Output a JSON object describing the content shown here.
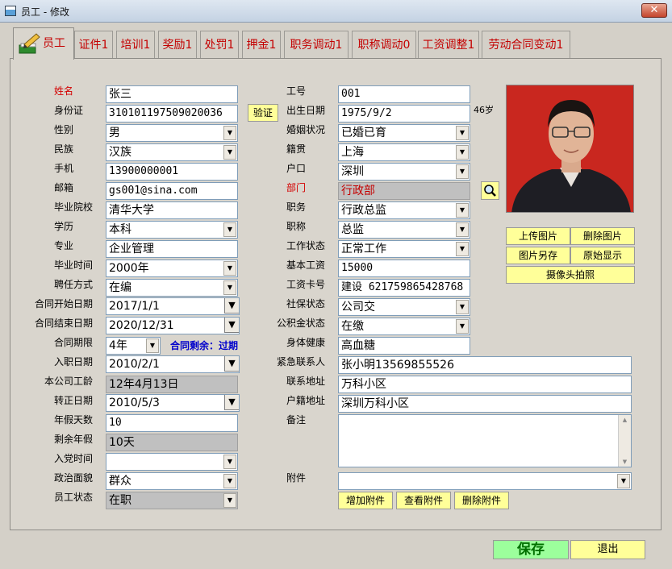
{
  "window": {
    "title": "员工 - 修改",
    "close_glyph": "✕"
  },
  "tabs": [
    "员工",
    "证件1",
    "培训1",
    "奖励1",
    "处罚1",
    "押金1",
    "职务调动1",
    "职称调动0",
    "工资调整1",
    "劳动合同变动1"
  ],
  "labels": {
    "name": "姓名",
    "id_card": "身份证",
    "gender": "性别",
    "ethnicity": "民族",
    "mobile": "手机",
    "email": "邮箱",
    "school": "毕业院校",
    "education": "学历",
    "major": "专业",
    "grad_time": "毕业时间",
    "hire_mode": "聘任方式",
    "contract_start": "合同开始日期",
    "contract_end": "合同结束日期",
    "contract_term": "合同期限",
    "join_date": "入职日期",
    "seniority": "本公司工龄",
    "regular_date": "转正日期",
    "annual_leave": "年假天数",
    "remaining_leave": "剩余年假",
    "party_time": "入党时间",
    "political": "政治面貌",
    "status": "员工状态",
    "emp_no": "工号",
    "birth_date": "出生日期",
    "marital": "婚姻状况",
    "native_place": "籍贯",
    "hukou": "户口",
    "department": "部门",
    "position": "职务",
    "title": "职称",
    "work_status": "工作状态",
    "base_salary": "基本工资",
    "salary_card": "工资卡号",
    "social_security": "社保状态",
    "housing_fund": "公积金状态",
    "health": "身体健康",
    "emergency": "紧急联系人",
    "address": "联系地址",
    "registered_address": "户籍地址",
    "remarks": "备注",
    "attachment": "附件"
  },
  "values": {
    "name": "张三",
    "id_card": "310101197509020036",
    "gender": "男",
    "ethnicity": "汉族",
    "mobile": "13900000001",
    "email": "gs001@sina.com",
    "school": "清华大学",
    "education": "本科",
    "major": "企业管理",
    "grad_time": "2000年",
    "hire_mode": "在编",
    "contract_start": "2017/1/1",
    "contract_end": "2020/12/31",
    "contract_term": "4年",
    "contract_remaining": "合同剩余：过期",
    "join_date": "2010/2/1",
    "seniority": "12年4月13日",
    "regular_date": "2010/5/3",
    "annual_leave": "10",
    "remaining_leave": "10天",
    "party_time": "",
    "political": "群众",
    "status": "在职",
    "emp_no": "001",
    "birth_date": "1975/9/2",
    "age": "46岁",
    "marital": "已婚已育",
    "native_place": "上海",
    "hukou": "深圳",
    "department": "行政部",
    "position": "行政总监",
    "title": "总监",
    "work_status": "正常工作",
    "base_salary": "15000",
    "salary_card": "建设 621759865428768",
    "social_security": "公司交",
    "housing_fund": "在缴",
    "health": "高血糖",
    "emergency": "张小明13569855526",
    "address": "万科小区",
    "registered_address": "深圳万科小区",
    "remarks": "",
    "attachment": ""
  },
  "buttons": {
    "verify": "验证",
    "upload_photo": "上传图片",
    "delete_photo": "删除图片",
    "save_photo_as": "图片另存",
    "original_display": "原始显示",
    "camera": "摄像头拍照",
    "add_attachment": "增加附件",
    "view_attachment": "查看附件",
    "delete_attachment": "删除附件",
    "save": "保存",
    "exit": "退出"
  },
  "icons": {
    "department_lookup": "magnifier-icon",
    "dropdown": "chevron-down-icon",
    "scroll_up": "▲",
    "scroll_down": "▼"
  },
  "colors": {
    "required_label": "#d40000",
    "save_bg": "#9cff9c",
    "button_bg": "#ffff99",
    "tab_text": "#c40000",
    "remaining_text": "#0000cc"
  }
}
